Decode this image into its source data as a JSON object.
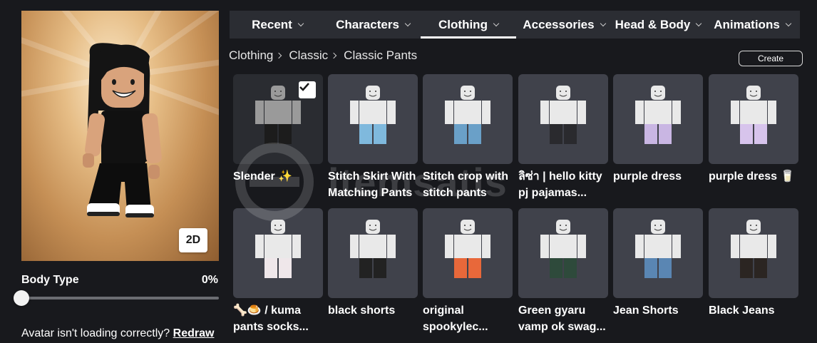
{
  "avatar_panel": {
    "view_toggle_label": "2D",
    "body_type": {
      "label": "Body Type",
      "value": "0%",
      "level": 0
    },
    "warning": {
      "text": "Avatar isn't loading correctly?",
      "link": "Redraw"
    }
  },
  "nav": {
    "tabs": [
      {
        "label": "Recent",
        "active": false
      },
      {
        "label": "Characters",
        "active": false
      },
      {
        "label": "Clothing",
        "active": true
      },
      {
        "label": "Accessories",
        "active": false
      },
      {
        "label": "Head & Body",
        "active": false
      },
      {
        "label": "Animations",
        "active": false
      }
    ]
  },
  "breadcrumb": {
    "items": [
      "Clothing",
      "Classic",
      "Classic Pants"
    ]
  },
  "create_label": "Create",
  "items": [
    {
      "name": "Slender ✨",
      "selected": true,
      "pants": "#1c1c1c",
      "top": "#9a9a9a",
      "icon": "rig-icon"
    },
    {
      "name": "Stitch Skirt With Matching Pants",
      "selected": false,
      "pants": "#7fb9dd",
      "icon": "mannequin-icon"
    },
    {
      "name": "Stitch crop with stitch pants",
      "selected": false,
      "pants": "#6aa0c8",
      "icon": "mannequin-icon"
    },
    {
      "name": "ลิซ่า | hello kitty pj pajamas...",
      "selected": false,
      "pants": "#2a2a2e",
      "icon": "mannequin-icon"
    },
    {
      "name": "purple dress",
      "selected": false,
      "pants": "#c9b6e3",
      "icon": "mannequin-icon"
    },
    {
      "name": "purple dress 🥛",
      "selected": false,
      "pants": "#d7c4ec",
      "icon": "mannequin-icon"
    },
    {
      "name": "🦴🍮 / kuma pants socks...",
      "selected": false,
      "pants": "#efe7ea",
      "icon": "mannequin-icon"
    },
    {
      "name": "black shorts",
      "selected": false,
      "pants": "#222222",
      "icon": "mannequin-icon"
    },
    {
      "name": "original spookylec...",
      "selected": false,
      "pants": "#e8683a",
      "icon": "mannequin-icon"
    },
    {
      "name": "Green gyaru vamp ok swag...",
      "selected": false,
      "pants": "#2e4a3b",
      "icon": "mannequin-icon"
    },
    {
      "name": "Jean Shorts",
      "selected": false,
      "pants": "#5a86b3",
      "icon": "mannequin-icon"
    },
    {
      "name": "Black Jeans",
      "selected": false,
      "pants": "#2b2522",
      "icon": "mannequin-icon"
    }
  ],
  "watermark": {
    "text": "itemsatis"
  },
  "colors": {
    "background": "#18191d",
    "nav_bar": "#2b2d33",
    "tile": "#40424b",
    "accent": "#ffffff"
  }
}
